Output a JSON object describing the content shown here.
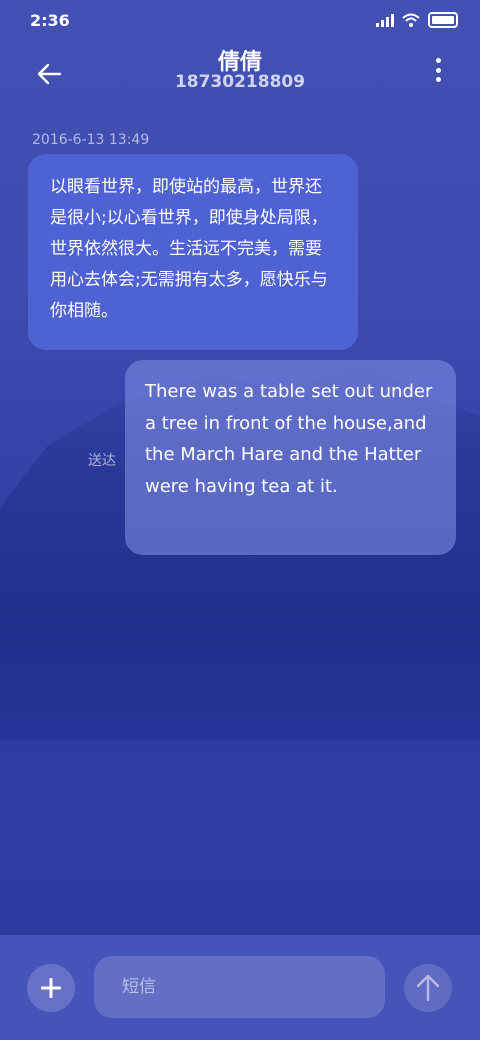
{
  "status_bar": {
    "time": "2:36"
  },
  "header": {
    "contact_name": "倩倩",
    "contact_number": "18730218809"
  },
  "conversation": {
    "timestamp": "2016-6-13 13:49",
    "incoming_message": "以眼看世界，即使站的最高，世界还是很小;以心看世界，即使身处局限，世界依然很大。生活远不完美，需要用心去体会;无需拥有太多，愿快乐与你相随。",
    "outgoing_message": "There was a table set out under a tree in front of the house,and the March Hare and the Hatter were having tea at it.",
    "outgoing_status": "送达"
  },
  "composer": {
    "placeholder": "短信"
  },
  "icons": {
    "back": "arrow-left-icon",
    "more": "more-vertical-icon",
    "add": "plus-icon",
    "send": "arrow-up-icon"
  },
  "colors": {
    "background": "#3d4bb0",
    "incoming_bubble": "#4f62d4",
    "outgoing_bubble": "#7d8ce1"
  }
}
